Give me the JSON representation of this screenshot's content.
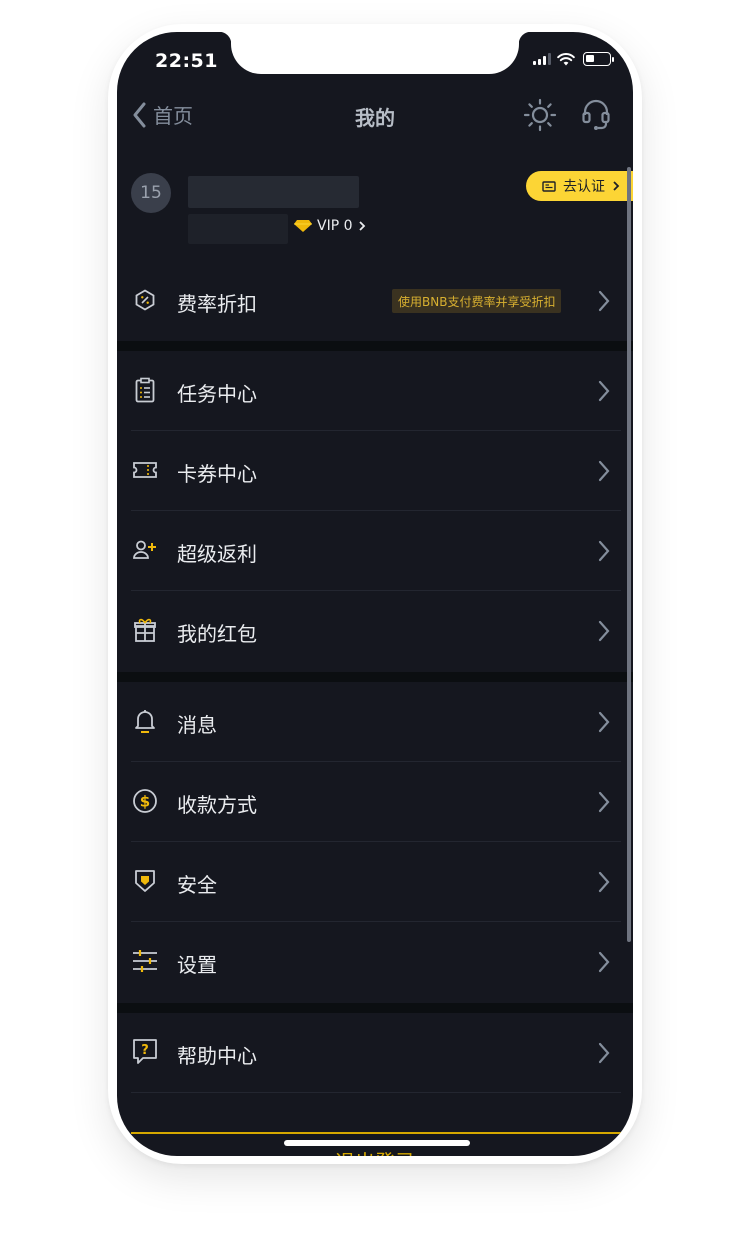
{
  "status_bar": {
    "time": "22:51"
  },
  "nav": {
    "back_label": "首页",
    "title": "我的"
  },
  "profile": {
    "avatar_text": "15",
    "vip_label": "VIP 0",
    "verify_label": "去认证"
  },
  "menu": {
    "fee": {
      "label": "费率折扣",
      "tag": "使用BNB支付费率并享受折扣"
    },
    "tasks": {
      "label": "任务中心"
    },
    "coupons": {
      "label": "卡券中心"
    },
    "rebate": {
      "label": "超级返利"
    },
    "redpacket": {
      "label": "我的红包"
    },
    "messages": {
      "label": "消息"
    },
    "payment": {
      "label": "收款方式"
    },
    "security": {
      "label": "安全"
    },
    "settings": {
      "label": "设置"
    },
    "help": {
      "label": "帮助中心"
    }
  },
  "logout_label": "退出登录",
  "colors": {
    "accent": "#fcd535",
    "background": "#15171f",
    "text": "#eaecef"
  }
}
